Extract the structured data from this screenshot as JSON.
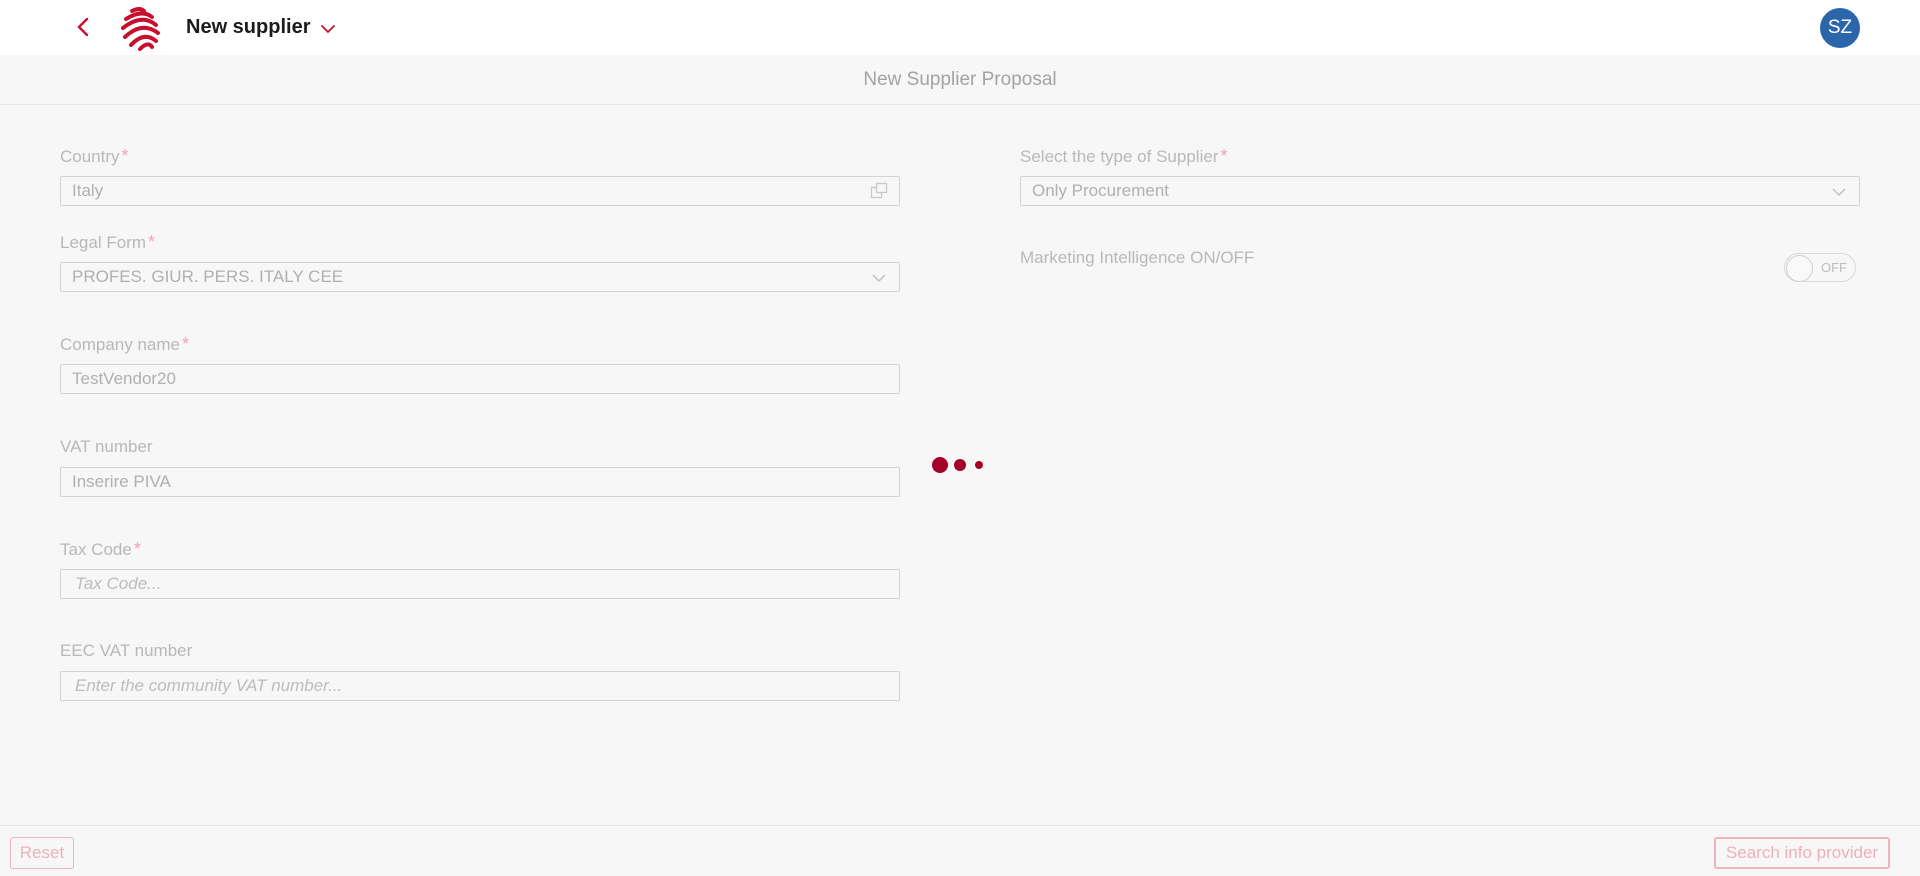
{
  "header": {
    "title": "New supplier",
    "avatar_initials": "SZ"
  },
  "page": {
    "subtitle": "New Supplier Proposal"
  },
  "form": {
    "country": {
      "label": "Country",
      "value": "Italy"
    },
    "legal_form": {
      "label": "Legal Form",
      "value": "PROFES. GIUR. PERS. ITALY CEE"
    },
    "company_name": {
      "label": "Company name",
      "value": "TestVendor20"
    },
    "vat_number": {
      "label": "VAT number",
      "value": "Inserire PIVA"
    },
    "tax_code": {
      "label": "Tax Code",
      "placeholder": "Tax Code..."
    },
    "eec_vat": {
      "label": "EEC VAT number",
      "placeholder": "Enter the community VAT number..."
    },
    "supplier_type": {
      "label": "Select the type of Supplier",
      "value": "Only Procurement"
    },
    "marketing": {
      "label": "Marketing Intelligence ON/OFF",
      "toggle_text": "OFF",
      "on": false
    },
    "required_mark": "*"
  },
  "footer": {
    "reset_label": "Reset",
    "search_label": "Search info provider"
  },
  "colors": {
    "brand": "#c8102e",
    "avatar": "#2b66ab",
    "loader": "#a5002a"
  },
  "icons": {
    "back": "chevron-left-icon",
    "title_dropdown": "chevron-down-icon",
    "country_lookup": "open-lookup-icon",
    "select_arrow": "chevron-down-icon"
  }
}
